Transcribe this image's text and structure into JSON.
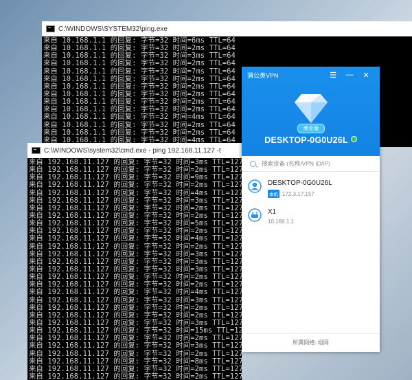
{
  "win1": {
    "title": "C:\\WINDOWS\\SYSTEM32\\ping.exe",
    "lines": [
      "来自 10.168.1.1 的回复: 字节=32 时间=6ms TTL=64",
      "来自 10.168.1.1 的回复: 字节=32 时间=2ms TTL=64",
      "来自 10.168.1.1 的回复: 字节=32 时间=3ms TTL=64",
      "来自 10.168.1.1 的回复: 字节=32 时间=2ms TTL=64",
      "来自 10.168.1.1 的回复: 字节=32 时间=7ms TTL=64",
      "来自 10.168.1.1 的回复: 字节=32 时间=2ms TTL=64",
      "来自 10.168.1.1 的回复: 字节=32 时间=2ms TTL=64",
      "来自 10.168.1.1 的回复: 字节=32 时间=2ms TTL=64",
      "来自 10.168.1.1 的回复: 字节=32 时间=2ms TTL=64",
      "来自 10.168.1.1 的回复: 字节=32 时间=2ms TTL=64",
      "来自 10.168.1.1 的回复: 字节=32 时间=4ms TTL=64",
      "来自 10.168.1.1 的回复: 字节=32 时间=2ms TTL=64",
      "来自 10.168.1.1 的回复: 字节=32 时间=2ms TTL=64",
      "来自 10.168.1.1 的回复: 字节=32 时间=4ms TTL=64"
    ]
  },
  "win2": {
    "title": "C:\\WINDOWS\\system32\\cmd.exe - ping  192.168.11.127 -t",
    "lines": [
      "来自 192.168.11.127 的回复: 字节=32 时间=3ms TTL=127",
      "来自 192.168.11.127 的回复: 字节=32 时间=2ms TTL=127",
      "来自 192.168.11.127 的回复: 字节=32 时间=9ms TTL=127",
      "来自 192.168.11.127 的回复: 字节=32 时间=2ms TTL=127",
      "来自 192.168.11.127 的回复: 字节=32 时间=4ms TTL=127",
      "来自 192.168.11.127 的回复: 字节=32 时间=3ms TTL=127",
      "来自 192.168.11.127 的回复: 字节=32 时间=2ms TTL=127",
      "来自 192.168.11.127 的回复: 字节=32 时间=2ms TTL=127",
      "来自 192.168.11.127 的回复: 字节=32 时间=5ms TTL=127",
      "来自 192.168.11.127 的回复: 字节=32 时间=2ms TTL=127",
      "来自 192.168.11.127 的回复: 字节=32 时间=4ms TTL=127",
      "来自 192.168.11.127 的回复: 字节=32 时间=2ms TTL=127",
      "来自 192.168.11.127 的回复: 字节=32 时间=3ms TTL=127",
      "来自 192.168.11.127 的回复: 字节=32 时间=3ms TTL=127",
      "来自 192.168.11.127 的回复: 字节=32 时间=3ms TTL=127",
      "来自 192.168.11.127 的回复: 字节=32 时间=2ms TTL=127",
      "来自 192.168.11.127 的回复: 字节=32 时间=2ms TTL=127",
      "来自 192.168.11.127 的回复: 字节=32 时间=4ms TTL=127",
      "来自 192.168.11.127 的回复: 字节=32 时间=3ms TTL=127",
      "来自 192.168.11.127 的回复: 字节=32 时间=2ms TTL=127",
      "来自 192.168.11.127 的回复: 字节=32 时间=2ms TTL=127",
      "来自 192.168.11.127 的回复: 字节=32 时间=3ms TTL=127",
      "来自 192.168.11.127 的回复: 字节=32 时间=15ms TTL=127",
      "来自 192.168.11.127 的回复: 字节=32 时间=2ms TTL=127",
      "来自 192.168.11.127 的回复: 字节=32 时间=3ms TTL=127",
      "来自 192.168.11.127 的回复: 字节=32 时间=2ms TTL=127",
      "来自 192.168.11.127 的回复: 字节=32 时间=8ms TTL=127",
      "来自 192.168.11.127 的回复: 字节=32 时间=2ms TTL=127",
      "来自 192.168.11.127 的回复: 字节=32 时间=2ms TTL=127"
    ]
  },
  "vpn": {
    "title": "蒲公英VPN",
    "edition_badge": "商业版",
    "device_name": "DESKTOP-0G0U26L",
    "search_placeholder": "搜索设备 (名称/VPN ID/IP)",
    "devices": [
      {
        "name": "DESKTOP-0G0U26L",
        "tag": "本机",
        "ip": "172.3.17.157",
        "icon": "user-avatar-icon"
      },
      {
        "name": "X1",
        "tag": "",
        "ip": "10.168.1.1",
        "icon": "router-icon"
      }
    ],
    "footer": "所属网络: 组网",
    "colors": {
      "header": "#1483e3",
      "online": "#34c85a"
    }
  }
}
